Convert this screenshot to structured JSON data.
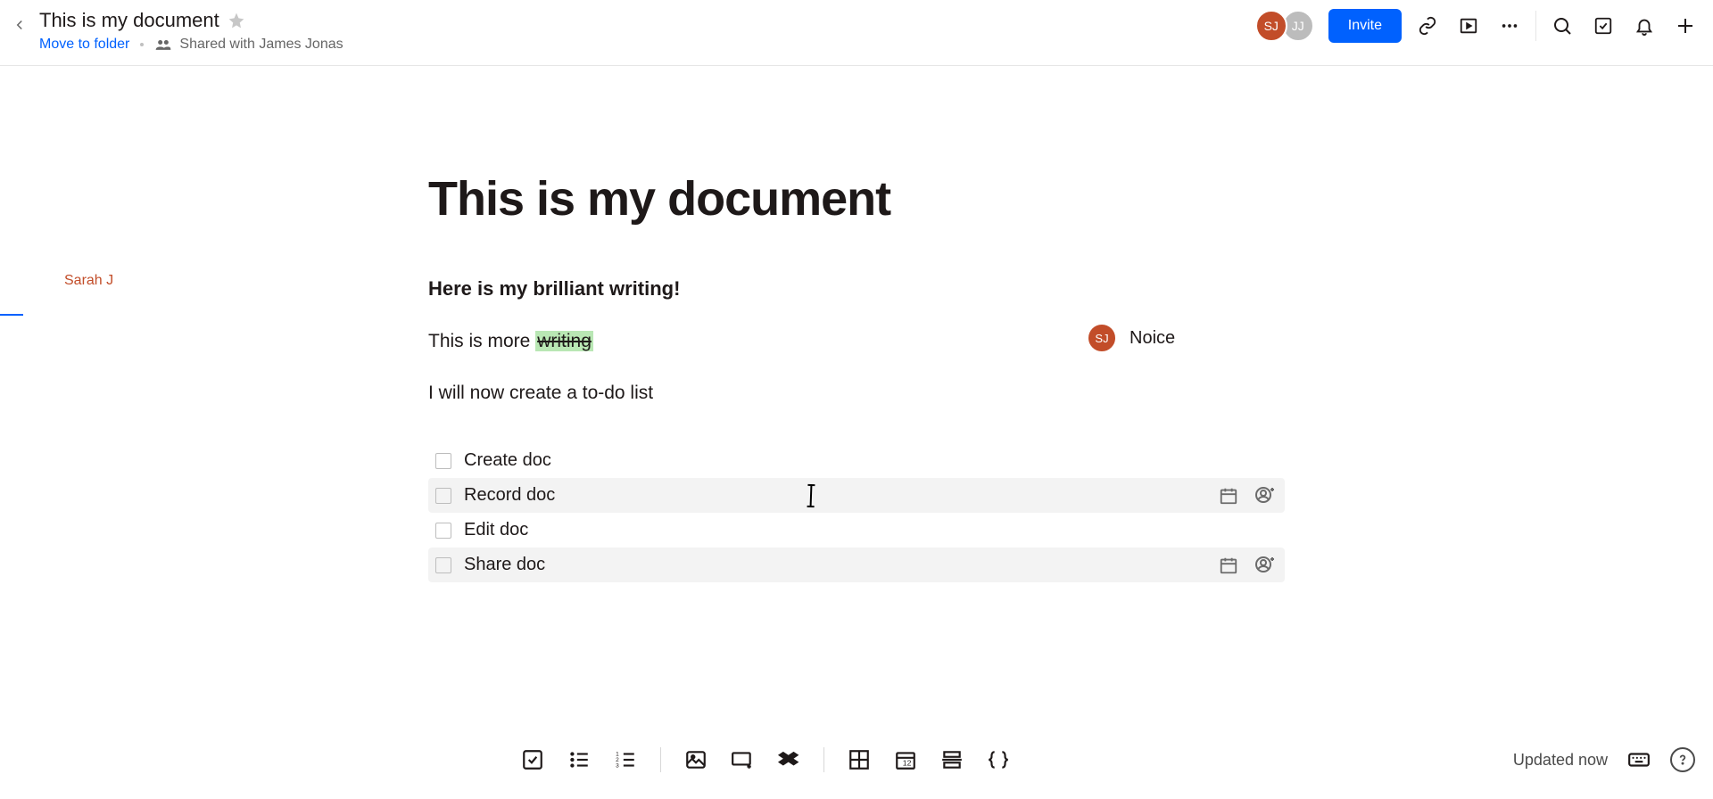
{
  "header": {
    "doc_title": "This is my document",
    "move_link": "Move to folder",
    "shared_with_prefix": "Shared with",
    "shared_with_name": "James Jonas",
    "avatars": [
      {
        "initials": "SJ",
        "class": "sj"
      },
      {
        "initials": "JJ",
        "class": "jj"
      }
    ],
    "invite_label": "Invite"
  },
  "author": {
    "name": "Sarah J"
  },
  "document": {
    "title": "This is my document",
    "intro": "Here is my brilliant writing!",
    "para_before_highlight": "This is more ",
    "para_highlight": "writing",
    "para2": "I will now create a to-do list",
    "todos": [
      {
        "label": "Create doc",
        "hover": false,
        "show_actions": false
      },
      {
        "label": "Record doc",
        "hover": true,
        "show_actions": true,
        "show_cursor": true
      },
      {
        "label": "Edit doc",
        "hover": false,
        "show_actions": false
      },
      {
        "label": "Share doc",
        "hover": true,
        "show_actions": true
      }
    ]
  },
  "comment": {
    "avatar_initials": "SJ",
    "text": "Noice"
  },
  "bottombar": {
    "updated_text": "Updated now",
    "icons": {
      "checklist": "checklist-icon",
      "bullets": "bulleted-list-icon",
      "numbered": "numbered-list-icon",
      "image": "image-icon",
      "screen": "screen-add-icon",
      "dropbox": "dropbox-icon",
      "table": "table-icon",
      "calendar": "calendar-icon",
      "divider": "divider-icon",
      "code": "code-braces-icon"
    }
  },
  "icons": {
    "back": "chevron-left-icon",
    "star": "star-outline-icon",
    "people": "people-icon",
    "link": "link-icon",
    "play": "screen-play-icon",
    "more": "more-horizontal-icon",
    "search": "search-icon",
    "tasks": "checkbox-icon",
    "bell": "bell-icon",
    "plus": "plus-icon",
    "calendar_small": "calendar-icon",
    "assign": "assign-person-icon",
    "keyboard": "keyboard-icon",
    "help": "help-icon"
  }
}
